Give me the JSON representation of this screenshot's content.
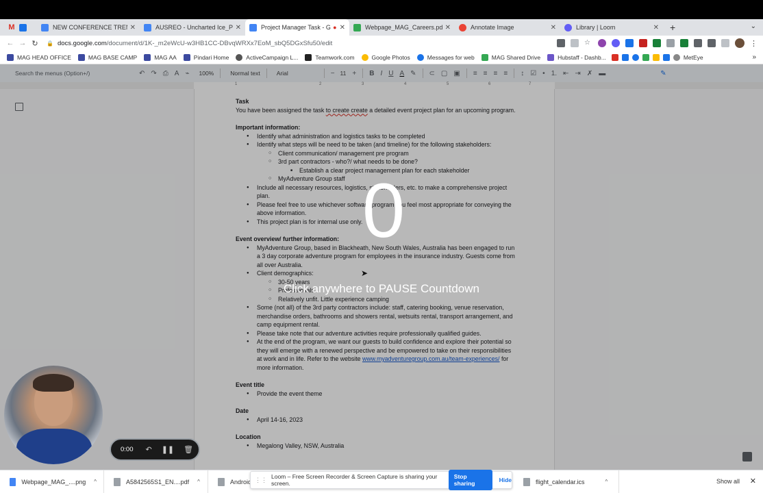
{
  "browser": {
    "tabs": [
      {
        "title": "",
        "icon": "gmail-icon",
        "color": "#d93025"
      },
      {
        "title": "",
        "icon": "calendar-icon",
        "color": "#1a73e8"
      },
      {
        "title": "NEW CONFERENCE TRENDS F",
        "icon": "docs-icon",
        "color": "#4285f4"
      },
      {
        "title": "AUSREO - Uncharted Ice_Prop",
        "icon": "docs-icon",
        "color": "#4285f4"
      },
      {
        "title": "Project Manager Task - Go",
        "icon": "docs-icon",
        "color": "#4285f4",
        "active": true
      },
      {
        "title": "Webpage_MAG_Careers.pdf",
        "icon": "drive-icon",
        "color": "#34a853"
      },
      {
        "title": "Annotate Image",
        "icon": "annotate-icon",
        "color": "#ea4335"
      },
      {
        "title": "Library | Loom",
        "icon": "loom-icon",
        "color": "#625df5"
      }
    ],
    "url_host": "docs.google.com",
    "url_path": "/document/d/1K-_m2eWcU-w3HB1CC-DBvqWRXx7EoM_sbQ5DGxSfu50/edit",
    "bookmarks": [
      {
        "label": "MAG HEAD OFFICE",
        "color": "#3c4aa0"
      },
      {
        "label": "MAG BASE CAMP",
        "color": "#3c4aa0"
      },
      {
        "label": "MAG AA",
        "color": "#3c4aa0"
      },
      {
        "label": "Pindari Home",
        "color": "#3c4aa0"
      },
      {
        "label": "ActiveCampaign L...",
        "color": "#555555"
      },
      {
        "label": "Teamwork.com",
        "color": "#222222"
      },
      {
        "label": "Google Photos",
        "color": "#fbbc04"
      },
      {
        "label": "Messages for web",
        "color": "#1a73e8"
      },
      {
        "label": "MAG Shared Drive",
        "color": "#34a853"
      },
      {
        "label": "Hubstaff - Dashb...",
        "color": "#6b56c8"
      },
      {
        "label": "MetEye",
        "color": "#888888"
      }
    ]
  },
  "docs_toolbar": {
    "search_placeholder": "Search the menus (Option+/)",
    "zoom": "100%",
    "style": "Normal text",
    "font": "Arial",
    "font_size": "11"
  },
  "ruler_numbers": [
    "1",
    "2",
    "3",
    "4",
    "5",
    "6",
    "7"
  ],
  "document": {
    "task_heading": "Task",
    "task_text_a": "You have been assigned the task ",
    "task_text_b": "to create create",
    "task_text_c": " a detailed event project plan for an upcoming program.",
    "important_heading": "Important information:",
    "imp_1": "Identify what administration and logistics tasks to be completed",
    "imp_2": "Identify what steps will be need to be taken (and timeline) for the following stakeholders:",
    "imp_2a": "Client communication/ management pre program",
    "imp_2b": "3rd part contractors - who?/ what needs to be done?",
    "imp_2b1": "Establish a clear project management plan for each stakeholder",
    "imp_2c": "MyAdventure Group staff",
    "imp_3": "Include all necessary resources, logistics, stakeholders, etc. to make a comprehensive project plan.",
    "imp_4": "Please feel free to use whichever software program you feel most appropriate for conveying the above information.",
    "imp_5": "This project plan is for internal use only.",
    "overview_heading": "Event overview/ further information:",
    "ov_1": "MyAdventure Group, based in Blackheath, New South Wales, Australia has been engaged to run a 3 day corporate adventure program for employees in the insurance industry. Guests come from all over Australia.",
    "ov_2": "Client demographics:",
    "ov_2a": "30-50 years",
    "ov_2b": "Professionals",
    "ov_2c": "Relatively unfit. Little experience camping",
    "ov_3": "Some (not all) of the 3rd party contractors include: staff, catering booking, venue reservation, merchandise orders, bathrooms and showers rental, wetsuits rental, transport arrangement, and camp equipment rental.",
    "ov_4": "Please take note that our adventure activities require professionally qualified guides.",
    "ov_5": "At the end of the program, we want our guests to build confidence and explore their potential so they will emerge with a renewed perspective and be empowered to take on their responsibilities at work and in life. Refer to the website ",
    "ov_5_link": "www.myadventuregroup.com.au/team-experiences/",
    "ov_5_tail": " for more information.",
    "title_heading": "Event title",
    "title_item": "Provide the event theme",
    "date_heading": "Date",
    "date_item": "April 14-16, 2023",
    "location_heading": "Location",
    "location_item": "Megalong Valley, NSW, Australia"
  },
  "overlay": {
    "countdown": "0",
    "instruction": "Click anywhere to PAUSE Countdown"
  },
  "loom": {
    "timer": "0:00",
    "share_text": "Loom – Free Screen Recorder & Screen Capture is sharing your screen.",
    "stop_label": "Stop sharing",
    "hide_label": "Hide"
  },
  "downloads": {
    "items": [
      "Webpage_MAG_....png",
      "A5842565S1_EN....pdf",
      "AndroidM",
      "flight_calendar.ics"
    ],
    "show_all": "Show all"
  }
}
